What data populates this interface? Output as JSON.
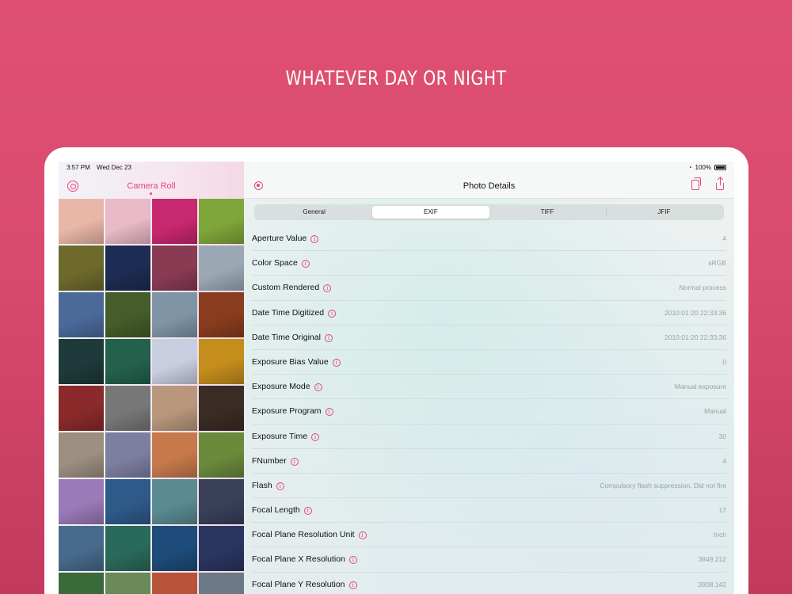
{
  "headline": "WHATEVER DAY OR NIGHT",
  "status": {
    "time": "3:57 PM",
    "date": "Wed Dec 23",
    "battery": "100%"
  },
  "sidebar": {
    "title": "Camera Roll",
    "thumbnails": [
      "#e9b7a8",
      "#e8b9c6",
      "#c8286f",
      "#7fa63a",
      "#6e6a2c",
      "#1d2c52",
      "#8a3b54",
      "#9aa8b4",
      "#4b6a9a",
      "#445d2a",
      "#7f95a6",
      "#8a3d1e",
      "#1e3a3a",
      "#23614c",
      "#c9cde0",
      "#c48d1c",
      "#8a2a2a",
      "#777777",
      "#b8977c",
      "#3a2c24",
      "#9c8f80",
      "#7d7fa0",
      "#c7794b",
      "#6a8a3c",
      "#9a7ab8",
      "#2e5a8a",
      "#5a8a92",
      "#3a3f5a",
      "#486a8c",
      "#2a6a5a",
      "#1e4c7a",
      "#2a3560",
      "#3a6a3a",
      "#6a8a5a",
      "#b8543a",
      "#6c7a88"
    ]
  },
  "detail": {
    "title": "Photo Details",
    "tabs": [
      "General",
      "EXIF",
      "TIFF",
      "JFIF"
    ],
    "active_tab": "EXIF",
    "rows": [
      {
        "label": "Aperture Value",
        "value": "4"
      },
      {
        "label": "Color Space",
        "value": "sRGB"
      },
      {
        "label": "Custom Rendered",
        "value": "Normal process"
      },
      {
        "label": "Date Time Digitized",
        "value": "2010:01:20 22:33:36"
      },
      {
        "label": "Date Time Original",
        "value": "2010:01:20 22:33:36"
      },
      {
        "label": "Exposure Bias Value",
        "value": "0"
      },
      {
        "label": "Exposure Mode",
        "value": "Manual exposure"
      },
      {
        "label": "Exposure Program",
        "value": "Manual"
      },
      {
        "label": "Exposure Time",
        "value": "30"
      },
      {
        "label": "FNumber",
        "value": "4"
      },
      {
        "label": "Flash",
        "value": "Compulsory flash suppression, Did not fire"
      },
      {
        "label": "Focal Length",
        "value": "17"
      },
      {
        "label": "Focal Plane Resolution Unit",
        "value": "Inch"
      },
      {
        "label": "Focal Plane X Resolution",
        "value": "3849.212"
      },
      {
        "label": "Focal Plane Y Resolution",
        "value": "3908.142"
      }
    ]
  },
  "colors": {
    "accent": "#e8457a",
    "background": "#d84a6e"
  },
  "icons": {
    "settings": "settings-icon",
    "record": "record-icon",
    "copy": "copy-icon",
    "share": "share-icon",
    "info": "info-icon",
    "wifi": "wifi-icon",
    "battery": "battery-icon"
  }
}
